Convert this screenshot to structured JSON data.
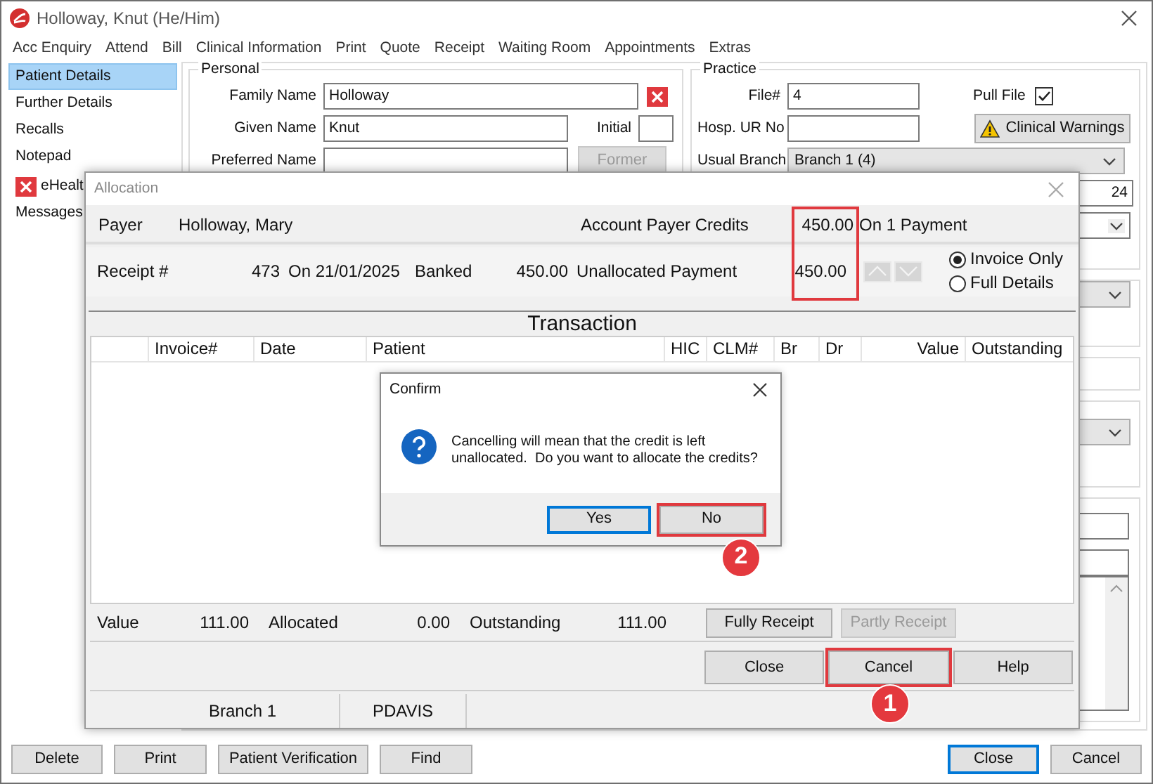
{
  "window": {
    "title": "Holloway, Knut (He/Him)"
  },
  "menu": [
    "Acc Enquiry",
    "Attend",
    "Bill",
    "Clinical Information",
    "Print",
    "Quote",
    "Receipt",
    "Waiting Room",
    "Appointments",
    "Extras"
  ],
  "sidebar": {
    "items": [
      {
        "label": "Patient Details",
        "selected": true,
        "kind": "plain"
      },
      {
        "label": "Further Details",
        "selected": false,
        "kind": "plain"
      },
      {
        "label": "Recalls",
        "selected": false,
        "kind": "plain"
      },
      {
        "label": "Notepad",
        "selected": false,
        "kind": "plain"
      },
      {
        "label": "eHealt",
        "selected": false,
        "kind": "flagged"
      },
      {
        "label": "Messages",
        "selected": false,
        "kind": "plain"
      }
    ]
  },
  "personal": {
    "title": "Personal",
    "family_name": {
      "label": "Family Name",
      "value": "Holloway"
    },
    "given_name": {
      "label": "Given Name",
      "value": "Knut"
    },
    "initial": {
      "label": "Initial"
    },
    "preferred_name": {
      "label": "Preferred Name"
    },
    "former_button": {
      "label": "Former",
      "disabled": true
    }
  },
  "practice": {
    "title": "Practice",
    "file": {
      "label": "File#",
      "value": "4"
    },
    "pull_file": {
      "label": "Pull File",
      "checked": true
    },
    "hosp_ur": {
      "label": "Hosp. UR No"
    },
    "clinical_warnings": "Clinical Warnings",
    "usual_branch": {
      "label": "Usual Branch",
      "value": "Branch 1  (4)"
    },
    "partial_field": "24"
  },
  "footer_left": [
    {
      "label": "Delete",
      "focused": false
    },
    {
      "label": "Print",
      "focused": false
    },
    {
      "label": "Patient Verification",
      "focused": false
    },
    {
      "label": "Find",
      "focused": false
    }
  ],
  "footer_right": [
    {
      "label": "Close",
      "focused": true
    },
    {
      "label": "Cancel",
      "focused": false
    }
  ],
  "allocation": {
    "title": "Allocation",
    "payer_label": "Payer",
    "payer": "Holloway, Mary",
    "credits_label": "Account Payer Credits",
    "credits": "450.00",
    "credits_note": "On 1 Payment",
    "receipt_label": "Receipt #",
    "receipt_no": "473",
    "receipt_date": "On 21/01/2025",
    "receipt_status": "Banked",
    "receipt_amount": "450.00",
    "unallocated_label": "Unallocated Payment",
    "unallocated": "450.00",
    "amounts_highlighted": true,
    "view_options": [
      {
        "label": "Invoice Only",
        "selected": true
      },
      {
        "label": "Full Details",
        "selected": false
      }
    ],
    "section_title": "Transaction",
    "columns": [
      "Invoice#",
      "Date",
      "Patient",
      "HIC",
      "CLM#",
      "Br",
      "Dr",
      "Value",
      "Outstanding"
    ],
    "totals": [
      {
        "label": "Value",
        "value": "111.00"
      },
      {
        "label": "Allocated",
        "value": "0.00"
      },
      {
        "label": "Outstanding",
        "value": "111.00"
      }
    ],
    "receipt_buttons": [
      {
        "label": "Fully Receipt",
        "disabled": false
      },
      {
        "label": "Partly Receipt",
        "disabled": true
      }
    ],
    "buttons": [
      {
        "label": "Close",
        "highlighted": false
      },
      {
        "label": "Cancel",
        "highlighted": true,
        "step": "1"
      },
      {
        "label": "Help",
        "highlighted": false
      }
    ],
    "status_bar": [
      "Branch 1",
      "PDAVIS"
    ]
  },
  "confirm": {
    "title": "Confirm",
    "message": "Cancelling will mean that the credit is left unallocated.  Do you want to allocate the credits?",
    "buttons": [
      {
        "label": "Yes",
        "focused": true,
        "highlighted": false
      },
      {
        "label": "No",
        "focused": false,
        "highlighted": true,
        "step": "2"
      }
    ]
  }
}
